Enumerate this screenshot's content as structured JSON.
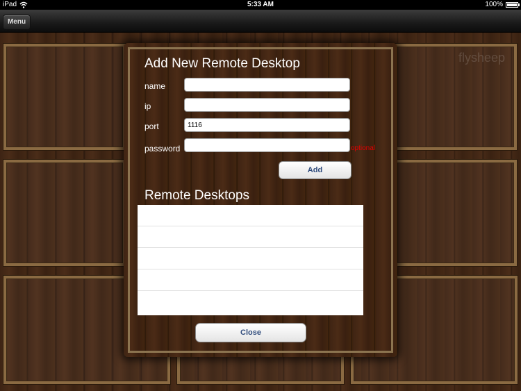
{
  "status_bar": {
    "carrier": "iPad",
    "time": "5:33 AM",
    "battery": "100%"
  },
  "nav": {
    "menu_label": "Menu"
  },
  "background": {
    "watermark": "flysheep"
  },
  "dialog": {
    "title": "Add New Remote Desktop",
    "fields": {
      "name": {
        "label": "name",
        "value": ""
      },
      "ip": {
        "label": "ip",
        "value": ""
      },
      "port": {
        "label": "port",
        "value": "1116"
      },
      "password": {
        "label": "password",
        "value": ""
      }
    },
    "optional_hint": "optional",
    "add_label": "Add",
    "list_title": "Remote Desktops",
    "list_rows": [
      "",
      "",
      "",
      "",
      ""
    ],
    "close_label": "Close"
  },
  "colors": {
    "optional_hint": "#e00000",
    "button_text": "#2f4b7c",
    "wood": "#4a2c18",
    "frame": "#8a6a42"
  },
  "icons": {
    "wifi": "wifi-icon",
    "battery": "battery-icon"
  }
}
